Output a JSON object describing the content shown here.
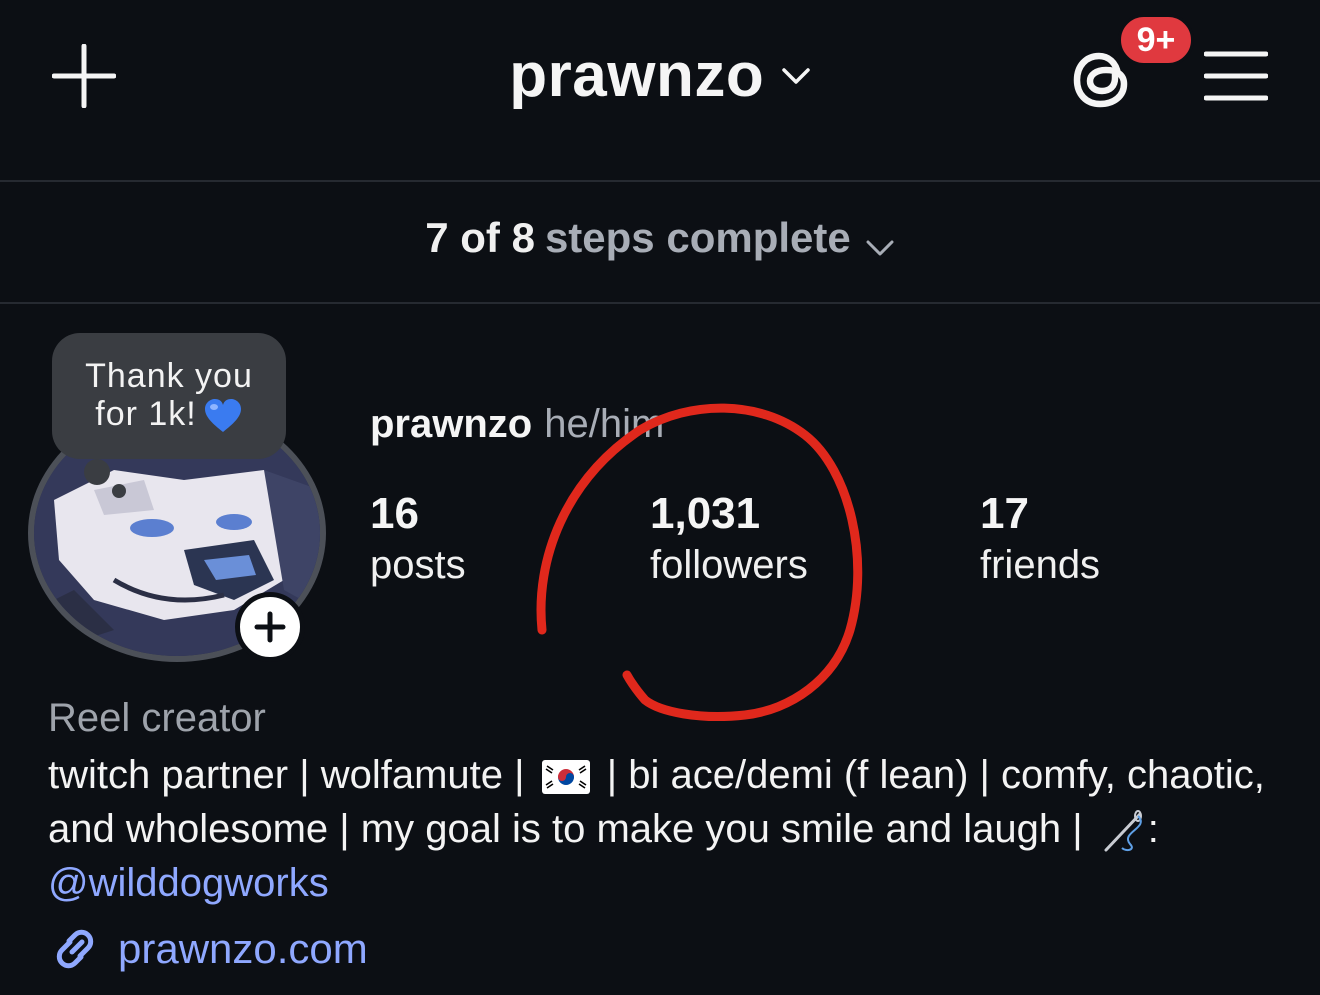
{
  "header": {
    "username": "prawnzo",
    "notification_badge": "9+",
    "badge_color": "#e0393f"
  },
  "steps": {
    "completed": "7 of 8",
    "label": "steps complete"
  },
  "note": {
    "line1": "Thank you",
    "line2": "for 1k!"
  },
  "profile": {
    "name": "prawnzo",
    "pronouns": "he/him",
    "stats": [
      {
        "value": "16",
        "label": "posts"
      },
      {
        "value": "1,031",
        "label": "followers"
      },
      {
        "value": "17",
        "label": "friends"
      }
    ],
    "category": "Reel creator",
    "bio_part1": "twitch partner | wolfamute | ",
    "bio_part2": " | bi ace/demi (f lean) | comfy, chaotic, and wholesome | my goal is to make you smile and laugh | ",
    "bio_part3": ": ",
    "mention": "@wilddogworks",
    "website": "prawnzo.com"
  },
  "colors": {
    "background": "#0c0f14",
    "link": "#8fa8ff",
    "annotation": "#e0281c"
  }
}
